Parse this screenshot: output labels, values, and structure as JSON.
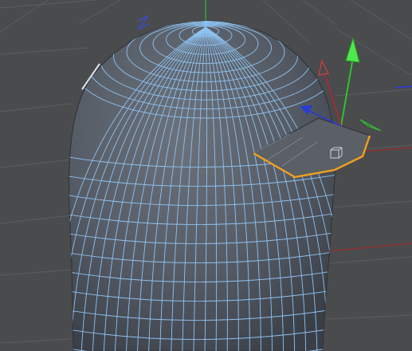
{
  "viewport": {
    "background": "#4a4b4d",
    "grid_color": "#5c5d60",
    "axis_x_color": "#b02a2a",
    "axis_y_color": "#2ec12e",
    "axis_z_color": "#2b3bd6",
    "mesh_fill": "#5a616c",
    "wire_color": "#8fc2f0",
    "selection_color": "#f0a020",
    "brim_fill": "#5b5f66"
  },
  "objects": [
    {
      "name": "capsule-mesh",
      "type": "polygon mesh"
    },
    {
      "name": "brim-polygon",
      "type": "extruded polygon",
      "selected": true
    }
  ],
  "gizmo": {
    "x_handle": "red-cone-handle",
    "y_handle": "green-arrow-handle",
    "z_handle": "blue-cone-handle"
  }
}
